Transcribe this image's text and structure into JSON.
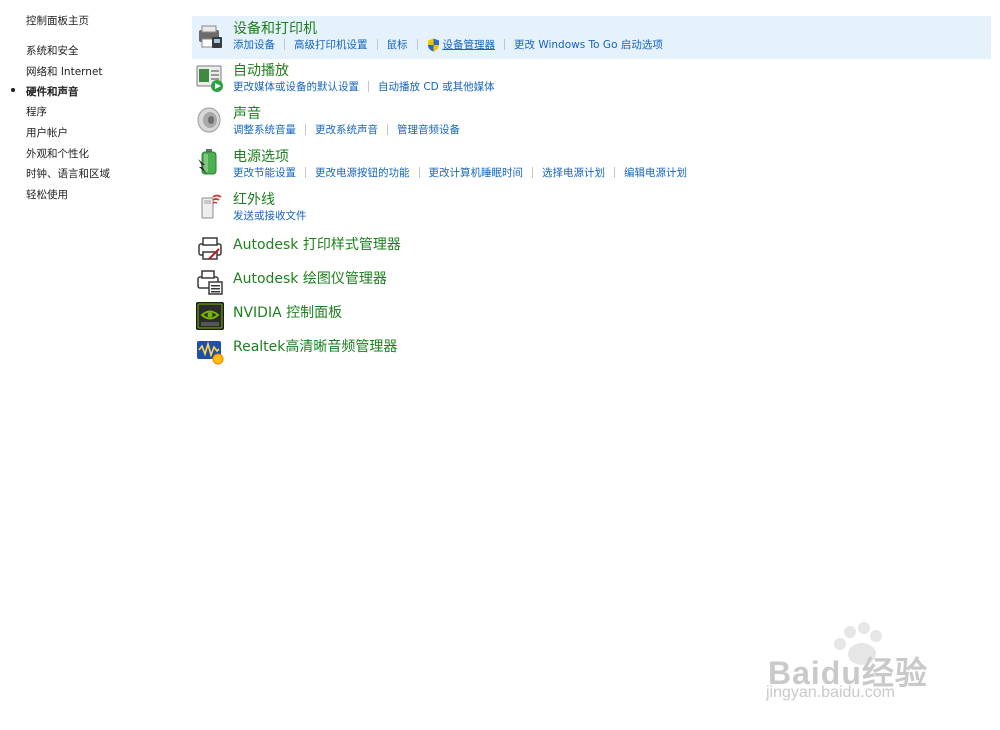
{
  "nav": {
    "home": "控制面板主页",
    "items": [
      "系统和安全",
      "网络和 Internet",
      "硬件和声音",
      "程序",
      "用户帐户",
      "外观和个性化",
      "时钟、语言和区域",
      "轻松使用"
    ],
    "current_index": 2
  },
  "categories": [
    {
      "title": "设备和打印机",
      "icon": "printer-device-icon",
      "links": [
        "添加设备",
        "高级打印机设置",
        "鼠标",
        "设备管理器",
        "更改 Windows To Go 启动选项"
      ]
    },
    {
      "title": "自动播放",
      "icon": "autoplay-icon",
      "links": [
        "更改媒体或设备的默认设置",
        "自动播放 CD 或其他媒体"
      ]
    },
    {
      "title": "声音",
      "icon": "speaker-icon",
      "links": [
        "调整系统音量",
        "更改系统声音",
        "管理音频设备"
      ]
    },
    {
      "title": "电源选项",
      "icon": "battery-power-icon",
      "links": [
        "更改节能设置",
        "更改电源按钮的功能",
        "更改计算机睡眠时间",
        "选择电源计划",
        "编辑电源计划"
      ]
    },
    {
      "title": "红外线",
      "icon": "infrared-icon",
      "links": [
        "发送或接收文件"
      ]
    },
    {
      "title": "Autodesk 打印样式管理器",
      "icon": "autodesk-plot-style-icon",
      "links": []
    },
    {
      "title": "Autodesk 绘图仪管理器",
      "icon": "autodesk-plotter-icon",
      "links": []
    },
    {
      "title": "NVIDIA 控制面板",
      "icon": "nvidia-icon",
      "links": []
    },
    {
      "title": "Realtek高清晰音频管理器",
      "icon": "realtek-audio-icon",
      "links": []
    }
  ],
  "colors": {
    "title_green": "#1d7f1d",
    "link_blue": "#1565c0",
    "hover_bg": "#e5f1fb"
  },
  "watermark": {
    "brand": "Baidu经验",
    "sub": "jingyan.baidu.com"
  }
}
